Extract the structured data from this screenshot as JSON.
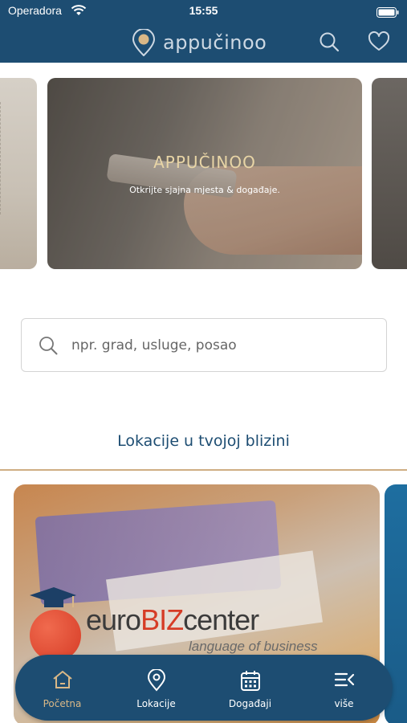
{
  "status_bar": {
    "carrier": "Operadora",
    "time": "15:55"
  },
  "header": {
    "brand": "appučinoo",
    "icons": [
      "search-icon",
      "heart-icon"
    ]
  },
  "carousel": {
    "slides": [
      {
        "title": "APPUČINOO",
        "subtitle": "Otkrijte sjajna mjesta & događaje."
      }
    ]
  },
  "search": {
    "placeholder": "npr. grad, usluge, posao",
    "value": ""
  },
  "nearby": {
    "title": "Lokacije u tvojoj blizini",
    "cards": [
      {
        "brand_main": "euro",
        "brand_accent": "BIZ",
        "brand_tail": "center",
        "tagline": "language of business"
      }
    ]
  },
  "bottom_nav": {
    "items": [
      {
        "label": "Početna",
        "icon": "home-icon",
        "active": true
      },
      {
        "label": "Lokacije",
        "icon": "location-pin-icon",
        "active": false
      },
      {
        "label": "Događaji",
        "icon": "calendar-icon",
        "active": false
      },
      {
        "label": "više",
        "icon": "menu-more-icon",
        "active": false
      }
    ]
  },
  "colors": {
    "primary": "#1d4d72",
    "accent": "#d9b887",
    "divider": "#cfae83"
  }
}
